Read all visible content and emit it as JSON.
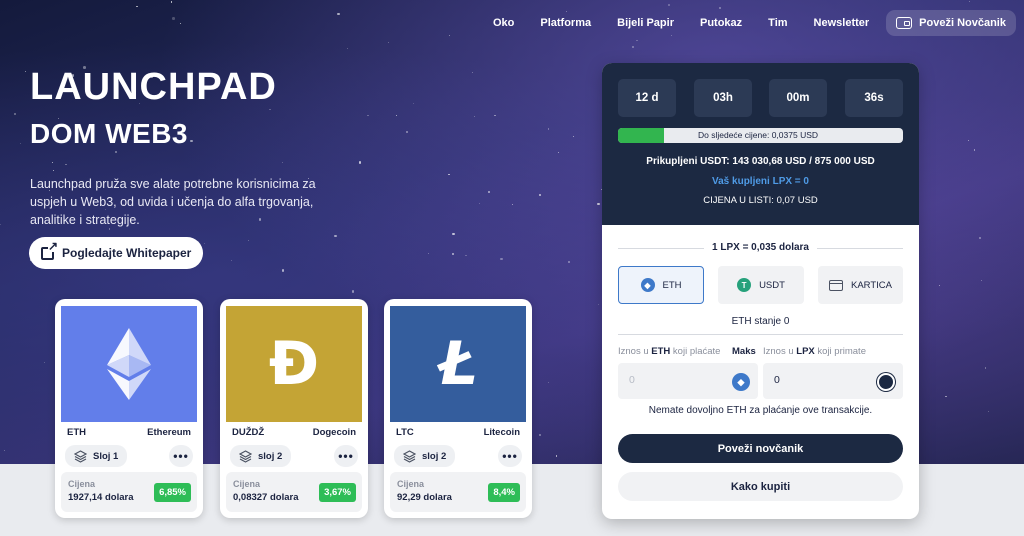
{
  "nav": {
    "items": [
      "Oko",
      "Platforma",
      "Bijeli Papir",
      "Putokaz",
      "Tim",
      "Newsletter"
    ],
    "wallet_button": "Poveži Novčanik"
  },
  "hero": {
    "title": "LAUNCHPAD",
    "subtitle": "DOM WEB3",
    "description": "Launchpad pruža sve alate potrebne korisnicima za uspjeh u Web3, od uvida i učenja do alfa trgovanja, analitike i strategije.",
    "whitepaper_button": "Pogledajte Whitepaper"
  },
  "cards": [
    {
      "symbol": "ETH",
      "name": "Ethereum",
      "layer": "Sloj 1",
      "price_label": "Cijena",
      "price": "1927,14 dolara",
      "change": "6,85%",
      "color": "#627eea",
      "glyph": "eth"
    },
    {
      "symbol": "DUŽDŽ",
      "name": "Dogecoin",
      "layer": "sloj 2",
      "price_label": "Cijena",
      "price": "0,08327 dolara",
      "change": "3,67%",
      "color": "#c4a435",
      "glyph": "Đ"
    },
    {
      "symbol": "LTC",
      "name": "Litecoin",
      "layer": "sloj 2",
      "price_label": "Cijena",
      "price": "92,29 dolara",
      "change": "8,4%",
      "color": "#345d9d",
      "glyph": "Ł"
    }
  ],
  "widget": {
    "timer": [
      "12 d",
      "03h",
      "00m",
      "36s"
    ],
    "progress_fraction": 0.16,
    "progress_text": "Do sljedeće cijene: 0,0375 USD",
    "raised": "Prikupljeni USDT: 143 030,68 USD / 875 000 USD",
    "your_lpx": "Vaš kupljeni LPX = 0",
    "listing_price": "CIJENA U LISTI: 0,07 USD",
    "rate": "1 LPX = 0,035 dolara",
    "pay_methods": [
      "ETH",
      "USDT",
      "KARTICA"
    ],
    "balance": "ETH stanje 0",
    "pay_label_pre": "Iznos u",
    "pay_label_coin": "ETH",
    "pay_label_post": "koji plaćate",
    "max_label": "Maks",
    "receive_label_pre": "Iznos u",
    "receive_label_coin": "LPX",
    "receive_label_post": "koji primate",
    "pay_value": "0",
    "receive_value": "0",
    "warning": "Nemate dovoljno ETH za plaćanje ove transakcije.",
    "connect_button": "Poveži novčanik",
    "how_to_buy_button": "Kako kupiti"
  },
  "colors": {
    "dark": "#1c2942",
    "green": "#2ebd57",
    "accent_blue": "#3e79c9"
  }
}
